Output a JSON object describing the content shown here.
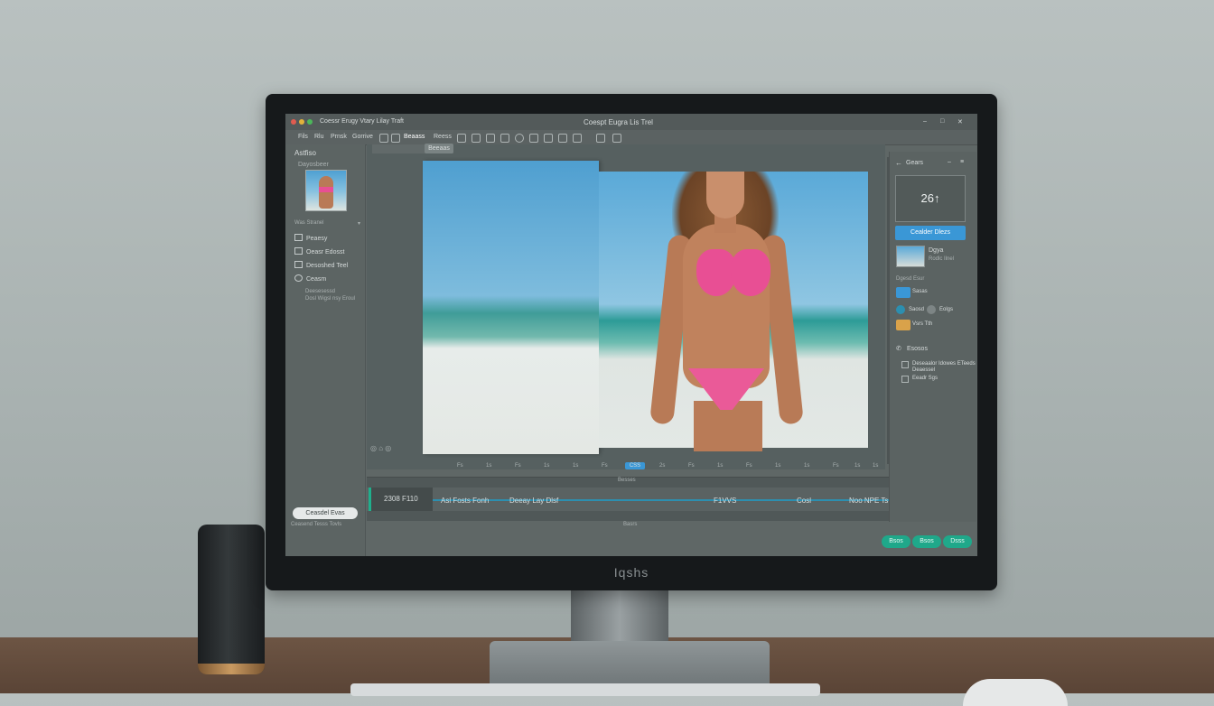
{
  "colors": {
    "accent": "#3a97d6",
    "teal_button": "#1fa88a",
    "bikini_pink": "#e84f94"
  },
  "monitor": {
    "brand": "Iqshs"
  },
  "window": {
    "title_left": "Coessr Erugy Vtary Lilay Traft",
    "title_center": "Coespt Eugra Lis Trel",
    "controls": [
      "–",
      "□",
      "✕"
    ]
  },
  "menubar": {
    "items": [
      "Fils",
      "Rlu",
      "Prnsk",
      "Gorrive"
    ],
    "active_tool_label": "Beaass",
    "tool_label_2": "Reess"
  },
  "tabs": [
    "Beeaas"
  ],
  "left_panel": {
    "heading": "Astfiso",
    "subheading": "Dayosbeer",
    "section_label": "Was Stranel",
    "nav_items": [
      "Peaesy",
      "Oeasr Edosst",
      "Desoshed Teel",
      "Ceasm"
    ],
    "note_lines": [
      "Deesesessd",
      "Dosl Wigsl nsy Eroul"
    ],
    "export_button": "Ceasdel Evas",
    "footer_link": "Ceasend Tesss Tovls"
  },
  "right_panel": {
    "header": "Gears",
    "size_value": "26↑",
    "apply_button": "Cealder Dlezs",
    "preset_title": "Dgya",
    "preset_sub": "Rodlc Ilnel",
    "section_label": "Dgesd Esur",
    "rows": [
      "Sasas",
      "Saosd",
      "Eolgs",
      "Vsrs Tth"
    ],
    "options_label": "Esosos",
    "checkbox_1": "Deseaalor Idowes ETeeds",
    "checkbox_1b": "Deaessel",
    "checkbox_2": "Eeadr Sgs"
  },
  "ruler": {
    "ticks": [
      "Fs",
      "1s",
      "Fs",
      "1s",
      "1s",
      "Fs",
      "2s",
      "Fs",
      "1s",
      "Fs",
      "1s",
      "1s",
      "Fs",
      "1s",
      "1s"
    ],
    "marker": "CSS"
  },
  "timeline": {
    "header": "Besses",
    "clip_label": "2308 F110",
    "labels": [
      "Asl Fosts Fonh",
      "Deeay Lay Dlsf",
      "F1VVS",
      "Cosl",
      "Noo NPE Ts"
    ],
    "footer": "Basrs"
  },
  "actions": [
    "Bsos",
    "Bsos",
    "Dsss"
  ]
}
